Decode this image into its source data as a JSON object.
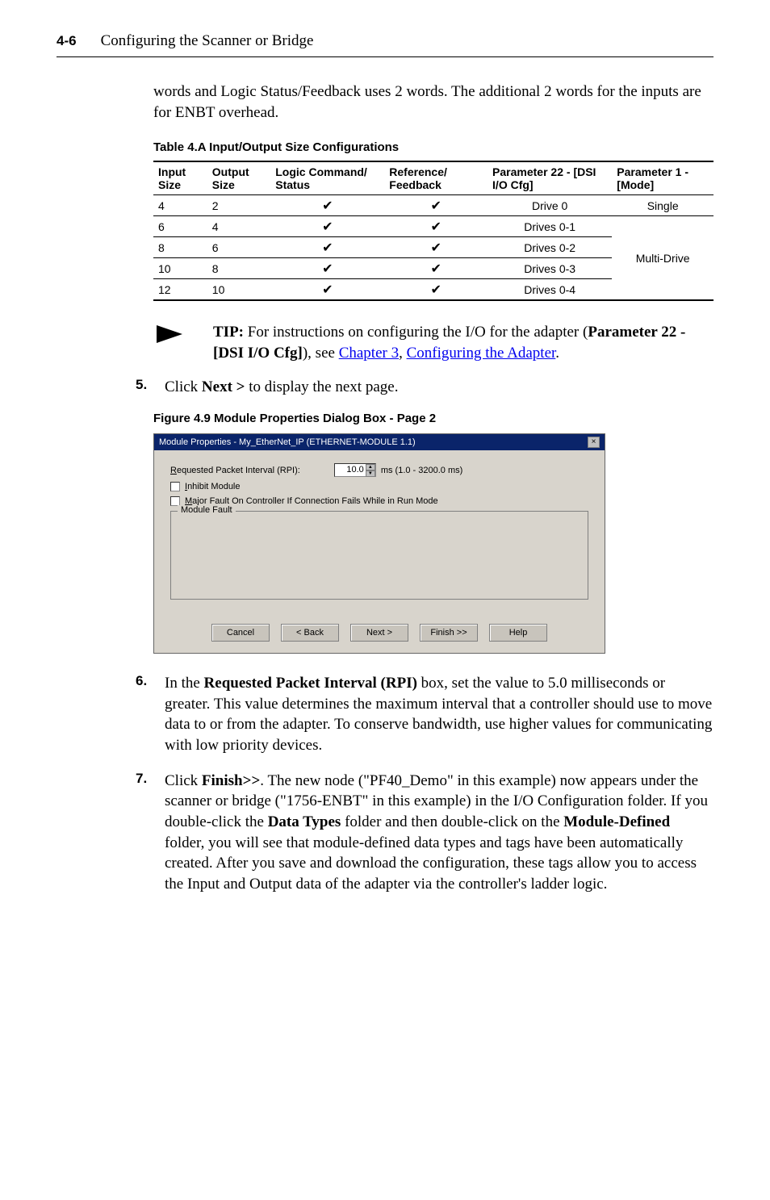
{
  "header": {
    "page_num": "4-6",
    "title": "Configuring the Scanner or Bridge"
  },
  "intro": "words and Logic Status/Feedback uses 2 words. The additional 2 words for the inputs are for ENBT overhead.",
  "table_caption": "Table 4.A   Input/Output Size Configurations",
  "table": {
    "headers": {
      "c1": "Input Size",
      "c2": "Output Size",
      "c3": "Logic Command/ Status",
      "c4": "Reference/ Feedback",
      "c5": "Parameter 22 - [DSI I/O Cfg]",
      "c6": "Parameter 1 - [Mode]"
    },
    "rows": [
      {
        "in": "4",
        "out": "2",
        "lcs": "✔",
        "rf": "✔",
        "p22": "Drive 0",
        "p1": "Single"
      },
      {
        "in": "6",
        "out": "4",
        "lcs": "✔",
        "rf": "✔",
        "p22": "Drives 0-1",
        "p1": ""
      },
      {
        "in": "8",
        "out": "6",
        "lcs": "✔",
        "rf": "✔",
        "p22": "Drives 0-2",
        "p1": "Multi-Drive"
      },
      {
        "in": "10",
        "out": "8",
        "lcs": "✔",
        "rf": "✔",
        "p22": "Drives 0-3",
        "p1": ""
      },
      {
        "in": "12",
        "out": "10",
        "lcs": "✔",
        "rf": "✔",
        "p22": "Drives 0-4",
        "p1": ""
      }
    ]
  },
  "tip": {
    "label": "TIP:",
    "body": "For instructions on configuring the I/O for the adapter (",
    "bold_insert": "Parameter 22 - [DSI I/O Cfg]",
    "after": "), see ",
    "link1": "Chapter 3",
    "comma": ", ",
    "link2": "Configuring the Adapter",
    "period": "."
  },
  "step5": {
    "num": "5.",
    "a": "Click ",
    "b": "Next >",
    "c": " to display the next page."
  },
  "fig_caption": "Figure 4.9   Module Properties Dialog Box - Page 2",
  "dialog": {
    "title": "Module Properties - My_EtherNet_IP (ETHERNET-MODULE 1.1)",
    "rpi_label_pre": "R",
    "rpi_label": "equested Packet Interval (RPI):",
    "rpi_value": "10.0",
    "rpi_units": "ms   (1.0 - 3200.0 ms)",
    "inhibit_pre": "I",
    "inhibit": "nhibit Module",
    "major_pre": "M",
    "major": "ajor Fault On Controller If Connection Fails While in Run Mode",
    "module_fault": "Module Fault",
    "btnCancel": "Cancel",
    "btnBack": "< Back",
    "btnNext": "Next >",
    "btnFinish": "Finish >>",
    "btnHelp": "Help"
  },
  "step6": {
    "num": "6.",
    "a": "In the ",
    "b": "Requested Packet Interval (RPI)",
    "c": " box, set the value to 5.0 milliseconds or greater. This value determines the maximum interval that a controller should use to move data to or from the adapter. To conserve bandwidth, use higher values for communicating with low priority devices."
  },
  "step7": {
    "num": "7.",
    "a": "Click ",
    "b": "Finish>>",
    "c": ". The new node (\"PF40_Demo\" in this example) now appears under the scanner or bridge (\"1756-ENBT\" in this example) in the I/O Configuration folder. If you double-click the ",
    "d": "Data Types",
    "e": " folder and then double-click on the ",
    "f": "Module-Defined",
    "g": " folder, you will see that module-defined data types and tags have been automatically created. After you save and download the configuration, these tags allow you to access the Input and Output data of the adapter via the controller's ladder logic."
  }
}
